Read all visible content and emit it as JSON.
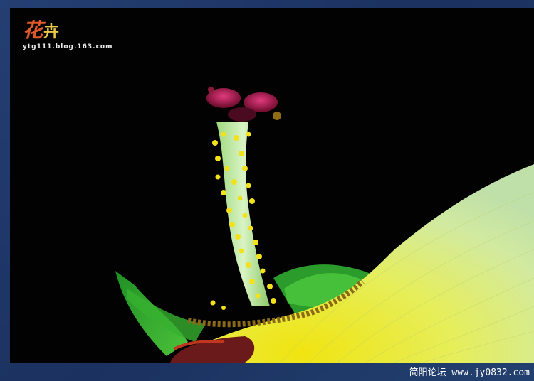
{
  "watermark": {
    "title_first": "花",
    "title_rest": "卉",
    "url": "ytg111.blog.163.com"
  },
  "footer": {
    "text": "简阳论坛 www.jy0832.com"
  },
  "colors": {
    "frame": "#1d3566",
    "background": "#020203",
    "petal_yellow": "#e8e02a",
    "petal_green": "#c9e28a",
    "leaf_green": "#2fa52a",
    "stigma_magenta": "#b0164e",
    "pollen_yellow": "#f3e21a"
  }
}
